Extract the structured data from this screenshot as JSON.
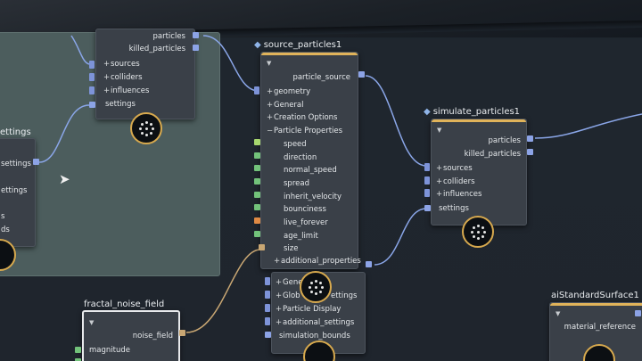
{
  "nodes": {
    "particle_settings": {
      "title_fragment": "ettings",
      "rows": [
        "settings",
        "ettings",
        "s",
        "ds"
      ]
    },
    "particles_top": {
      "outputs": [
        "particles",
        "killed_particles"
      ],
      "inputs": [
        "sources",
        "colliders",
        "influences"
      ],
      "settings": "settings"
    },
    "source_particles": {
      "title": "source_particles1",
      "output": "particle_source",
      "rows": [
        "geometry",
        "General",
        "Creation Options",
        "Particle Properties"
      ],
      "properties": [
        "speed",
        "direction",
        "normal_speed",
        "spread",
        "inherit_velocity",
        "bounciness",
        "live_forever",
        "age_limit",
        "size"
      ],
      "additional": "additional_properties"
    },
    "simulate_particles": {
      "title": "simulate_particles1",
      "outputs": [
        "particles",
        "killed_particles"
      ],
      "inputs": [
        "sources",
        "colliders",
        "influences"
      ],
      "settings": "settings"
    },
    "lower_node": {
      "rows": [
        "Gene",
        "Glob",
        "ettings",
        "Particle Display",
        "additional_settings",
        "simulation_bounds"
      ]
    },
    "fractal_noise": {
      "title": "fractal_noise_field",
      "output": "noise_field",
      "input": "magnitude"
    },
    "ai_surface": {
      "title": "aiStandardSurface1",
      "output": "material_reference"
    }
  },
  "colors": {
    "accent": "#e0b35a",
    "port": "#8ca3e6",
    "wire": "#8aa6e8",
    "wire_tan": "#c9a773",
    "subnet": "#4c5d5d"
  },
  "icons": [
    "collapse-chevron-icon",
    "plus-expand-icon",
    "minus-collapse-icon",
    "target-icon",
    "mouse-pointer-icon"
  ]
}
